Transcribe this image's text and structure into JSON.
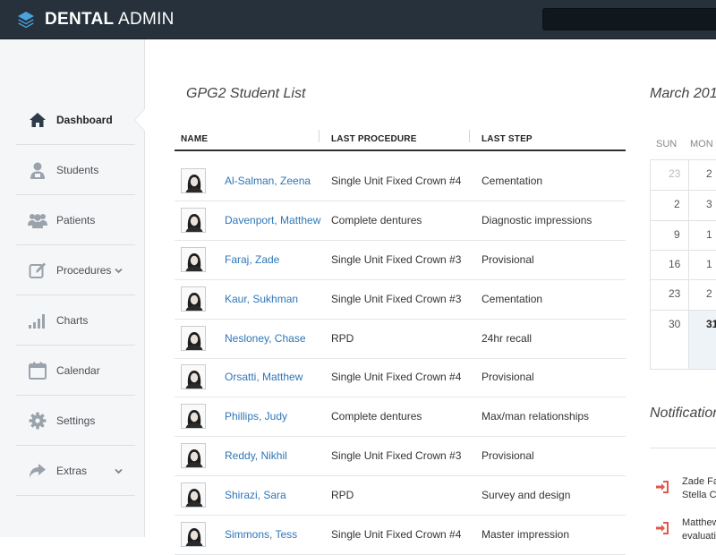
{
  "header": {
    "brand_bold": "DENTAL",
    "brand_light": "ADMIN",
    "logo_icon": "layers-icon"
  },
  "search": {
    "placeholder": ""
  },
  "sidebar": {
    "items": [
      {
        "label": "Dashboard",
        "icon": "home-icon",
        "active": true
      },
      {
        "label": "Students",
        "icon": "student-icon"
      },
      {
        "label": "Patients",
        "icon": "users-icon"
      },
      {
        "label": "Procedures",
        "icon": "edit-icon",
        "has_submenu": true
      },
      {
        "label": "Charts",
        "icon": "bar-chart-icon"
      },
      {
        "label": "Calendar",
        "icon": "calendar-icon"
      },
      {
        "label": "Settings",
        "icon": "gear-icon"
      },
      {
        "label": "Extras",
        "icon": "share-icon",
        "has_submenu": true
      }
    ]
  },
  "student_list": {
    "title": "GPG2 Student List",
    "columns": [
      "NAME",
      "LAST PROCEDURE",
      "LAST STEP"
    ],
    "rows": [
      {
        "name": "Al-Salman, Zeena",
        "procedure": "Single Unit Fixed Crown #4",
        "step": "Cementation"
      },
      {
        "name": "Davenport, Matthew",
        "procedure": "Complete dentures",
        "step": "Diagnostic impressions"
      },
      {
        "name": "Faraj, Zade",
        "procedure": "Single Unit Fixed Crown #3",
        "step": "Provisional"
      },
      {
        "name": "Kaur, Sukhman",
        "procedure": "Single Unit Fixed Crown #3",
        "step": "Cementation"
      },
      {
        "name": "Nesloney, Chase",
        "procedure": "RPD",
        "step": "24hr recall"
      },
      {
        "name": "Orsatti, Matthew",
        "procedure": "Single Unit Fixed Crown #4",
        "step": "Provisional"
      },
      {
        "name": "Phillips, Judy",
        "procedure": "Complete dentures",
        "step": "Max/man relationships"
      },
      {
        "name": "Reddy, Nikhil",
        "procedure": "Single Unit Fixed Crown #3",
        "step": "Provisional"
      },
      {
        "name": "Shirazi, Sara",
        "procedure": "RPD",
        "step": "Survey and design"
      },
      {
        "name": "Simmons, Tess",
        "procedure": "Single Unit Fixed Crown #4",
        "step": "Master impression"
      }
    ]
  },
  "calendar": {
    "title": "March 201",
    "day_names": [
      "SUN",
      "MON"
    ],
    "weeks": [
      [
        "23",
        "2"
      ],
      [
        "2",
        "3"
      ],
      [
        "9",
        "1"
      ],
      [
        "16",
        "1"
      ],
      [
        "23",
        "2"
      ],
      [
        "30",
        "31"
      ]
    ]
  },
  "notifications": {
    "title": "Notification",
    "items": [
      {
        "line1": "Zade Fa",
        "line2": "Stella C",
        "icon": "sign-in-icon"
      },
      {
        "line1": "Matthew",
        "line2": "evaluati",
        "icon": "sign-in-icon"
      }
    ]
  },
  "colors": {
    "topbar": "#26313b",
    "link": "#2f76b8",
    "notification_icon": "#e2574c"
  }
}
